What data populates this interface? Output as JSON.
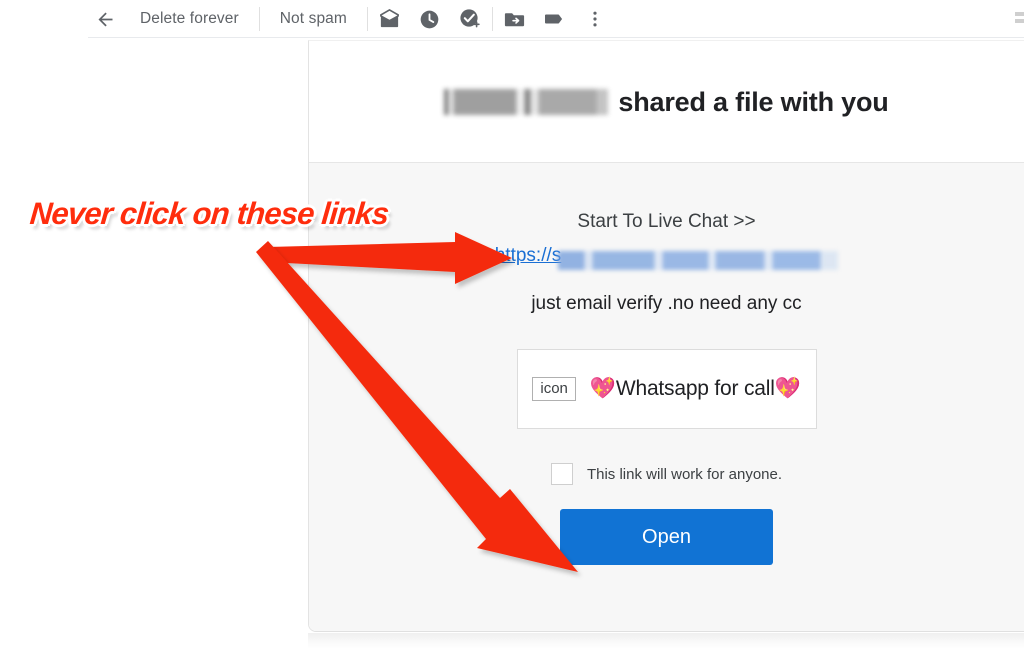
{
  "toolbar": {
    "back_label": "back-arrow",
    "delete_forever_label": "Delete forever",
    "not_spam_label": "Not spam",
    "icons": [
      {
        "name": "mark-unread-icon",
        "title": "Mark as unread"
      },
      {
        "name": "snooze-clock-icon",
        "title": "Snooze"
      },
      {
        "name": "add-to-tasks-icon",
        "title": "Add to tasks"
      },
      {
        "name": "move-to-folder-icon",
        "title": "Move to"
      },
      {
        "name": "labels-tag-icon",
        "title": "Labels"
      },
      {
        "name": "more-options-icon",
        "title": "More"
      }
    ]
  },
  "email": {
    "header": {
      "sender_redacted": "",
      "title_suffix": "shared a file with you"
    },
    "body": {
      "live_chat_line": "Start To Live Chat >>",
      "link_prefix": "https://s",
      "link_redacted": "",
      "verify_line": "just email verify .no need any cc",
      "whatsapp_box": {
        "broken_image_alt": "icon",
        "text": "💖Whatsapp for call💖"
      },
      "anyone_checkbox_label": "This link will work for anyone.",
      "open_button_label": "Open"
    }
  },
  "annotation": {
    "warning_text": "Never click on these links",
    "warning_color": "#ff2d0d",
    "arrow_color": "#f42a0c"
  },
  "colors": {
    "open_button": "#1173d4",
    "link_blue": "#1a6fd4",
    "panel_body_gray": "#f7f7f7",
    "toolbar_text": "#5f6368"
  }
}
